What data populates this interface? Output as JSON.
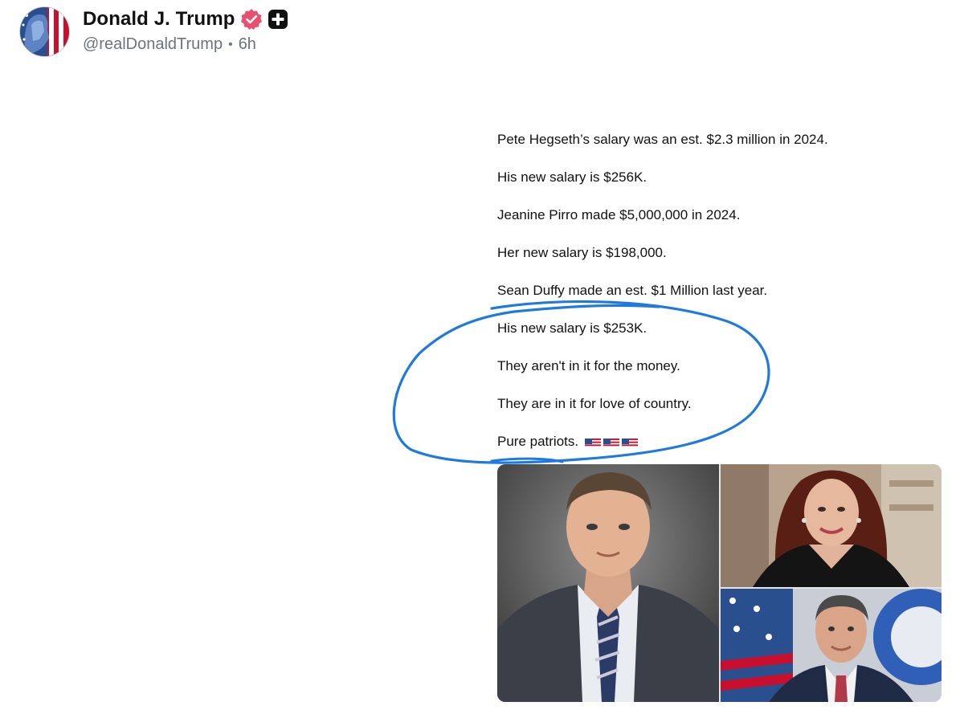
{
  "post": {
    "author_name": "Donald J. Trump",
    "handle": "@realDonaldTrump",
    "separator": "•",
    "timestamp": "6h",
    "badges": [
      "verified-badge-icon",
      "plus-badge-icon"
    ]
  },
  "embedded": {
    "lines": [
      "Pete Hegseth’s salary was an est. $2.3 million in 2024.",
      "His new salary is $256K.",
      "Jeanine Pirro made $5,000,000 in 2024.",
      "Her new salary is $198,000.",
      "Sean Duffy made an est. $1 Million last year.",
      "His new salary is $253K.",
      "They aren't in it for the money.",
      "They are in it for love of country.",
      "Pure patriots."
    ],
    "trailing_emoji": [
      "us-flag-icon",
      "us-flag-icon",
      "us-flag-icon"
    ],
    "photos": [
      "man-in-suit-photo",
      "woman-portrait-photo",
      "man-with-flag-photo"
    ]
  },
  "colors": {
    "annotation_circle": "#1f7ae0",
    "verified": "#e8506f",
    "text": "#111111",
    "muted": "#6b7280"
  }
}
